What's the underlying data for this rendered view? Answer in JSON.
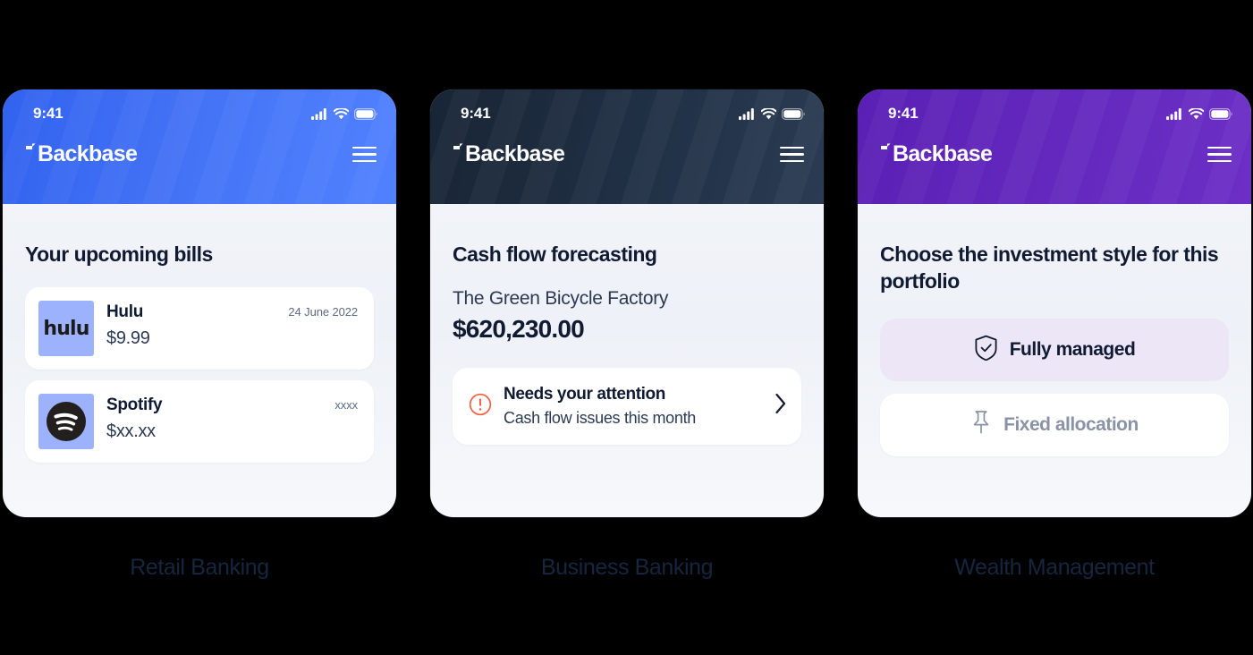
{
  "brand": {
    "name": "Backbase"
  },
  "status_bar": {
    "time": "9:41",
    "icons": [
      "signal-icon",
      "wifi-icon",
      "battery-icon"
    ]
  },
  "colors": {
    "page_background": "#000000",
    "retail_header": "#3f6df3",
    "business_header": "#1f2e42",
    "wealth_header": "#6327bd",
    "screen_background": "#f1f4f9",
    "card_surface": "#ffffff",
    "text_primary": "#101a33",
    "text_secondary": "#2c3a55",
    "text_muted": "#8a93a6",
    "logo_tile": "#9db2fc",
    "alert_accent": "#f4603e",
    "selected_option": "#ece6f7",
    "caption_text": "#16263f"
  },
  "phones": [
    {
      "id": "retail",
      "caption": "Retail Banking",
      "menu_label": "Menu",
      "title": "Your upcoming bills",
      "bills": [
        {
          "logo": "hulu-logo",
          "logo_text": "hulu",
          "name": "Hulu",
          "amount": "$9.99",
          "date": "24 June 2022"
        },
        {
          "logo": "spotify-logo",
          "logo_text": "",
          "name": "Spotify",
          "amount": "$xx.xx",
          "date": "xxxx"
        }
      ]
    },
    {
      "id": "business",
      "caption": "Business Banking",
      "menu_label": "Menu",
      "title": "Cash flow forecasting",
      "company": "The Green Bicycle Factory",
      "balance": "$620,230.00",
      "alert": {
        "icon": "alert-circle-icon",
        "title": "Needs your attention",
        "subtitle": "Cash flow issues this month",
        "chevron": "chevron-right-icon"
      }
    },
    {
      "id": "wealth",
      "caption": "Wealth Management",
      "menu_label": "Menu",
      "title": "Choose the investment style for this portfolio",
      "options": [
        {
          "icon": "shield-check-icon",
          "label": "Fully managed",
          "selected": true
        },
        {
          "icon": "pin-icon",
          "label": "Fixed allocation",
          "selected": false
        }
      ]
    }
  ]
}
